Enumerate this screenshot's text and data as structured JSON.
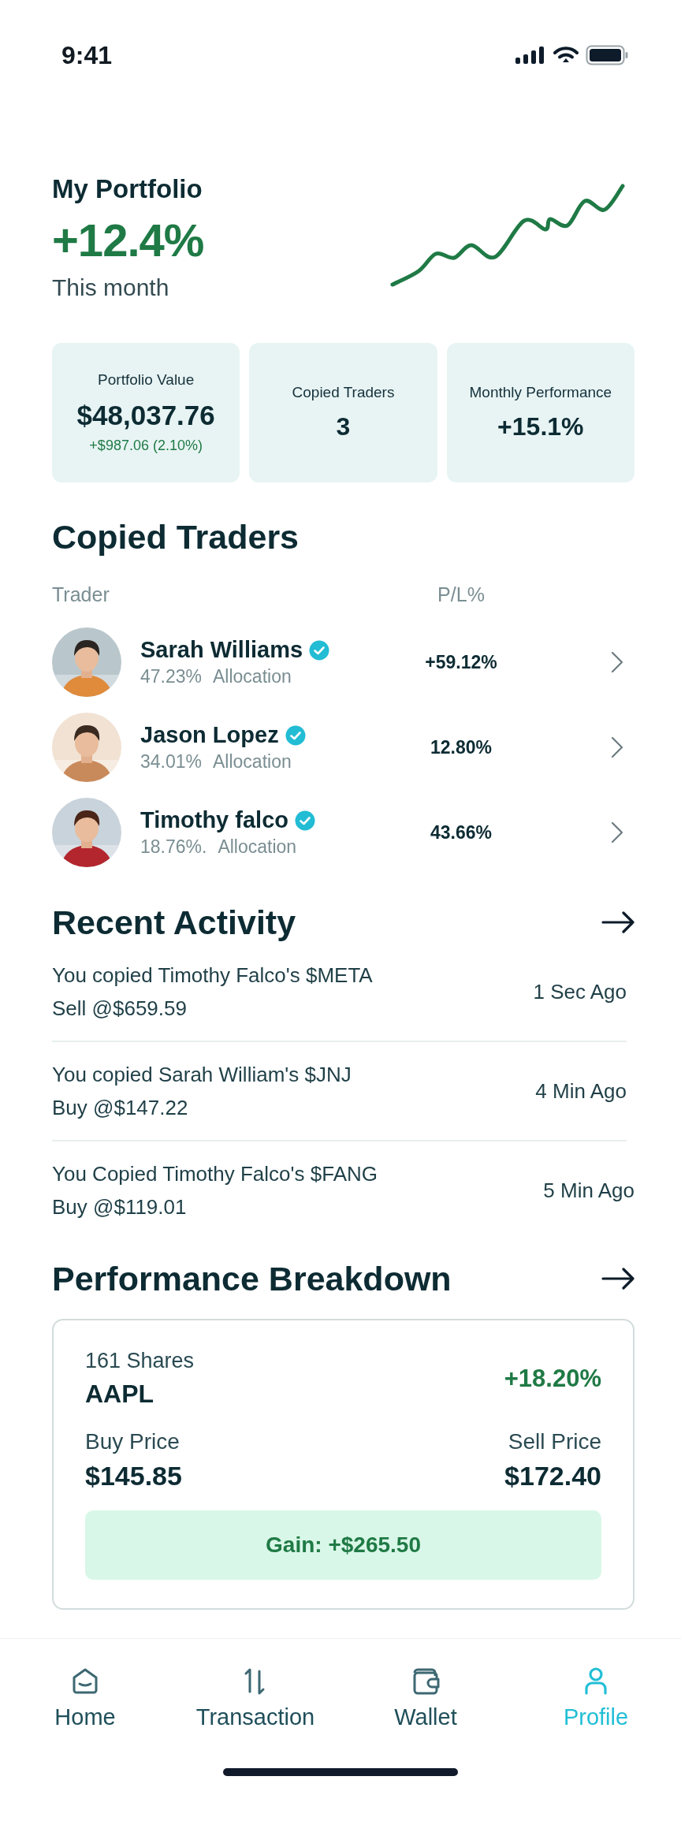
{
  "status_bar": {
    "time": "9:41"
  },
  "portfolio": {
    "title": "My Portfolio",
    "change": "+12.4%",
    "period": "This month"
  },
  "stats": [
    {
      "label": "Portfolio Value",
      "value": "$48,037.76",
      "delta": "+$987.06 (2.10%)"
    },
    {
      "label": "Copied Traders",
      "value": "3"
    },
    {
      "label": "Monthly Performance",
      "value": "+15.1%"
    }
  ],
  "copied_traders": {
    "title": "Copied Traders",
    "columns": [
      "Trader",
      "P/L%"
    ],
    "rows": [
      {
        "name": "Sarah Williams",
        "verified": true,
        "allocation": "47.23%",
        "allocation_label": "Allocation",
        "pl": "+59.12%"
      },
      {
        "name": "Jason Lopez",
        "verified": true,
        "allocation": "34.01%",
        "allocation_label": "Allocation",
        "pl": "12.80%"
      },
      {
        "name": "Timothy falco",
        "verified": true,
        "allocation": "18.76%.",
        "allocation_label": "Allocation",
        "pl": "43.66%"
      }
    ]
  },
  "recent_activity": {
    "title": "Recent Activity",
    "items": [
      {
        "text": "You copied Timothy Falco's $META",
        "detail": "Sell @$659.59",
        "time": "1 Sec Ago"
      },
      {
        "text": "You copied Sarah William's $JNJ",
        "detail": "Buy @$147.22",
        "time": "4 Min Ago"
      },
      {
        "text": "You Copied Timothy Falco's $FANG",
        "detail": "Buy @$119.01",
        "time": "5 Min Ago"
      }
    ]
  },
  "performance_breakdown": {
    "title": "Performance Breakdown",
    "shares": "161 Shares",
    "ticker": "AAPL",
    "change": "+18.20%",
    "buy_label": "Buy Price",
    "buy_price": "$145.85",
    "sell_label": "Sell Price",
    "sell_price": "$172.40",
    "gain": "Gain: +$265.50"
  },
  "nav": [
    {
      "kind": "home",
      "label": "Home",
      "selected": false
    },
    {
      "kind": "transaction",
      "label": "Transaction",
      "selected": false
    },
    {
      "kind": "wallet",
      "label": "Wallet",
      "selected": false
    },
    {
      "kind": "profile",
      "label": "Profile",
      "selected": true
    }
  ]
}
